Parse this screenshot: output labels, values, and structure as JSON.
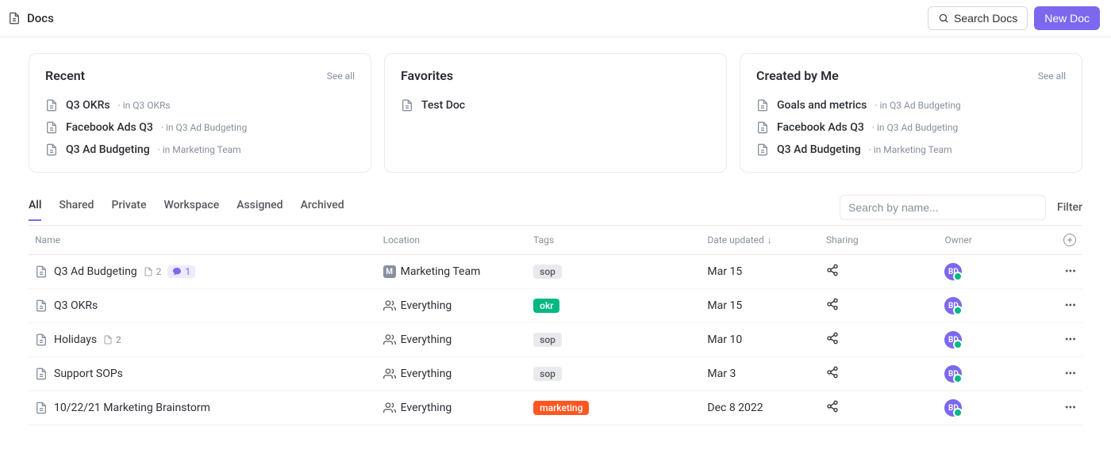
{
  "topbar": {
    "title": "Docs",
    "search_label": "Search Docs",
    "new_doc_label": "New Doc"
  },
  "cards": {
    "recent": {
      "title": "Recent",
      "see_all": "See all",
      "items": [
        {
          "name": "Q3 OKRs",
          "crumb": "· in Q3 OKRs"
        },
        {
          "name": "Facebook Ads Q3",
          "crumb": "· in Q3 Ad Budgeting"
        },
        {
          "name": "Q3 Ad Budgeting",
          "crumb": "· in Marketing Team"
        }
      ]
    },
    "favorites": {
      "title": "Favorites",
      "items": [
        {
          "name": "Test Doc",
          "crumb": ""
        }
      ]
    },
    "created": {
      "title": "Created by Me",
      "see_all": "See all",
      "items": [
        {
          "name": "Goals and metrics",
          "crumb": "· in Q3 Ad Budgeting"
        },
        {
          "name": "Facebook Ads Q3",
          "crumb": "· in Q3 Ad Budgeting"
        },
        {
          "name": "Q3 Ad Budgeting",
          "crumb": "· in Marketing Team"
        }
      ]
    }
  },
  "tabs": [
    "All",
    "Shared",
    "Private",
    "Workspace",
    "Assigned",
    "Archived"
  ],
  "active_tab": "All",
  "search_placeholder": "Search by name...",
  "filter_label": "Filter",
  "table": {
    "headers": {
      "name": "Name",
      "location": "Location",
      "tags": "Tags",
      "date": "Date updated",
      "sharing": "Sharing",
      "owner": "Owner"
    },
    "rows": [
      {
        "name": "Q3 Ad Budgeting",
        "subdocs": "2",
        "comments": "1",
        "loc_type": "space",
        "location": "Marketing Team",
        "tag": "sop",
        "tag_style": "sop",
        "date": "Mar 15",
        "owner": "BD"
      },
      {
        "name": "Q3 OKRs",
        "subdocs": "",
        "comments": "",
        "loc_type": "everything",
        "location": "Everything",
        "tag": "okr",
        "tag_style": "okr",
        "date": "Mar 15",
        "owner": "BD"
      },
      {
        "name": "Holidays",
        "subdocs": "2",
        "comments": "",
        "loc_type": "everything",
        "location": "Everything",
        "tag": "sop",
        "tag_style": "sop",
        "date": "Mar 10",
        "owner": "BD"
      },
      {
        "name": "Support SOPs",
        "subdocs": "",
        "comments": "",
        "loc_type": "everything",
        "location": "Everything",
        "tag": "sop",
        "tag_style": "sop",
        "date": "Mar 3",
        "owner": "BD"
      },
      {
        "name": "10/22/21 Marketing Brainstorm",
        "subdocs": "",
        "comments": "",
        "loc_type": "everything",
        "location": "Everything",
        "tag": "marketing",
        "tag_style": "marketing",
        "date": "Dec 8 2022",
        "owner": "BD"
      }
    ]
  },
  "loc_badge": "M"
}
